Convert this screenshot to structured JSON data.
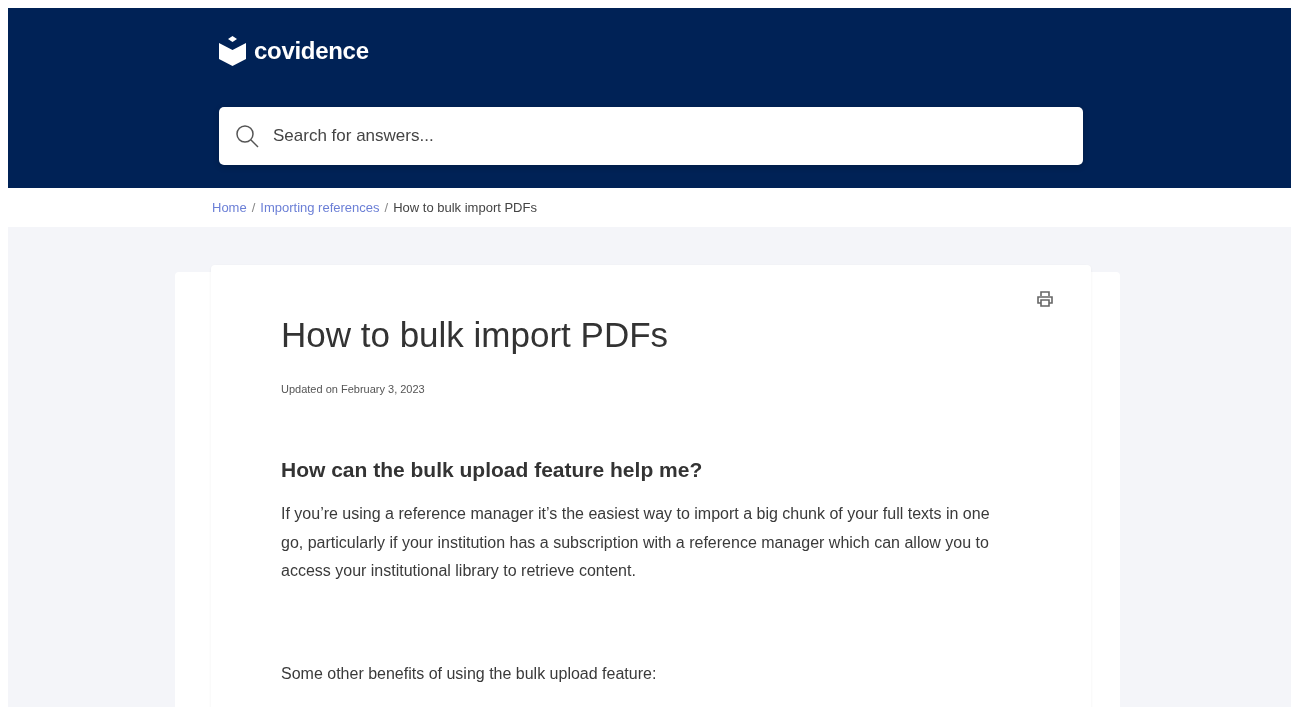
{
  "header": {
    "logo": "covidence",
    "search": {
      "placeholder": "Search for answers..."
    }
  },
  "breadcrumb_separator": "/",
  "breadcrumb": [
    {
      "label": "Home",
      "kind": "link"
    },
    {
      "label": "Importing references",
      "kind": "link"
    },
    {
      "label": "How to bulk import PDFs",
      "kind": "current"
    }
  ],
  "article": {
    "title": "How to bulk import PDFs",
    "updated": "Updated on February 3, 2023",
    "blocks": [
      {
        "kind": "heading",
        "text": "How can the bulk upload feature help me?"
      },
      {
        "kind": "paragraph",
        "text": "If you’re using a reference manager it’s the easiest way to import a big chunk of your full texts in one go, particularly if your institution has a subscription with a reference manager which can allow you to access your institutional library to retrieve content."
      },
      {
        "kind": "paragraph",
        "text": "Some other benefits of using the bulk upload feature:"
      }
    ]
  }
}
